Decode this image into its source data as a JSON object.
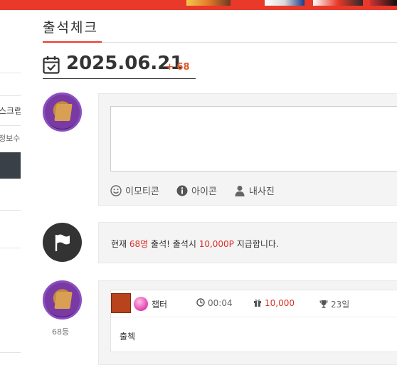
{
  "left_panel": {
    "item1": "스크랩",
    "item2": "정보수정"
  },
  "page": {
    "title": "출석체크"
  },
  "date": {
    "value": "2025.06.21",
    "plus": "+ 68"
  },
  "tools": {
    "emoticon": "이모티콘",
    "icon": "아이콘",
    "photo": "내사진"
  },
  "notice": {
    "prefix": "현재 ",
    "count": "68명",
    "middle": " 출석! 출석시 ",
    "points": "10,000P",
    "suffix": " 지급합니다."
  },
  "entry": {
    "nickname": "챕터",
    "time": "00:04",
    "points": "10,000",
    "days": "23일",
    "text": "출첵",
    "rank": "68등"
  },
  "colors": {
    "accent": "#e8392a",
    "highlight": "#d9322a",
    "plus": "#e05a28"
  }
}
